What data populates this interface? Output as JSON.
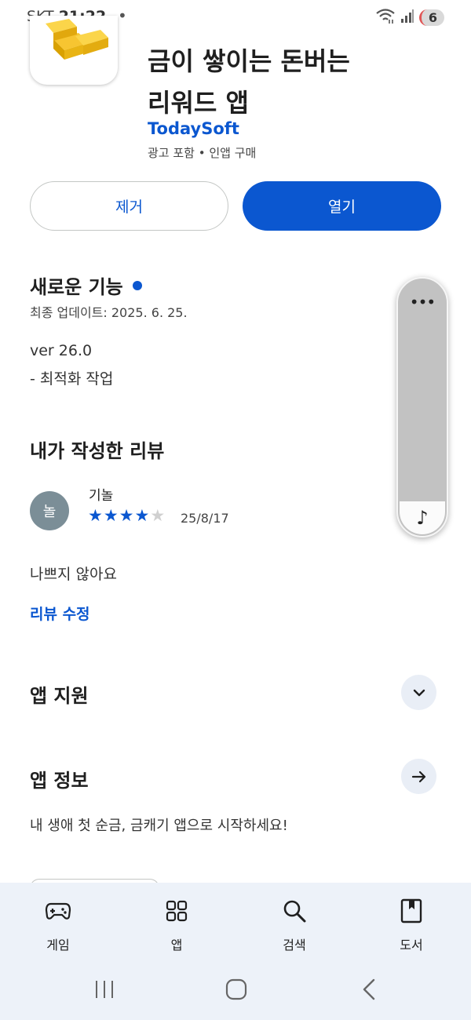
{
  "status_bar": {
    "carrier": "SKT",
    "time": "21:22",
    "dot": "•",
    "battery": "6",
    "icons": [
      "wifi-icon",
      "signal-icon"
    ]
  },
  "app": {
    "title_line1": "금이 쌓이는 돈버는",
    "title_line2": "리워드 앱",
    "developer": "TodaySoft",
    "meta": "광고 포함 • 인앱 구매",
    "icon": "gold-bars-icon"
  },
  "actions": {
    "uninstall": "제거",
    "open": "열기"
  },
  "whats_new": {
    "title": "새로운 기능",
    "updated": "최종 업데이트: 2025. 6. 25.",
    "version": "ver 26.0",
    "note": "- 최적화 작업"
  },
  "my_review": {
    "title": "내가 작성한 리뷰",
    "avatar_letter": "놀",
    "reviewer": "기놀",
    "rating": 4,
    "rating_max": 5,
    "date": "25/8/17",
    "text": "나쁘지 않아요",
    "edit_link": "리뷰 수정"
  },
  "sections": {
    "support_title": "앱 지원",
    "info_title": "앱 정보",
    "info_desc": "내 생애 첫 순금, 금캐기 앱으로 시작하세요!"
  },
  "floating_panel": {
    "more": "•••",
    "music": "♪"
  },
  "bottom_nav": [
    {
      "label": "게임",
      "icon": "gamepad-icon"
    },
    {
      "label": "앱",
      "icon": "apps-grid-icon"
    },
    {
      "label": "검색",
      "icon": "search-icon"
    },
    {
      "label": "도서",
      "icon": "book-icon"
    }
  ],
  "colors": {
    "accent": "#0b57d0",
    "nav_bg": "#edf2f9",
    "avatar_bg": "#7b8e97"
  }
}
